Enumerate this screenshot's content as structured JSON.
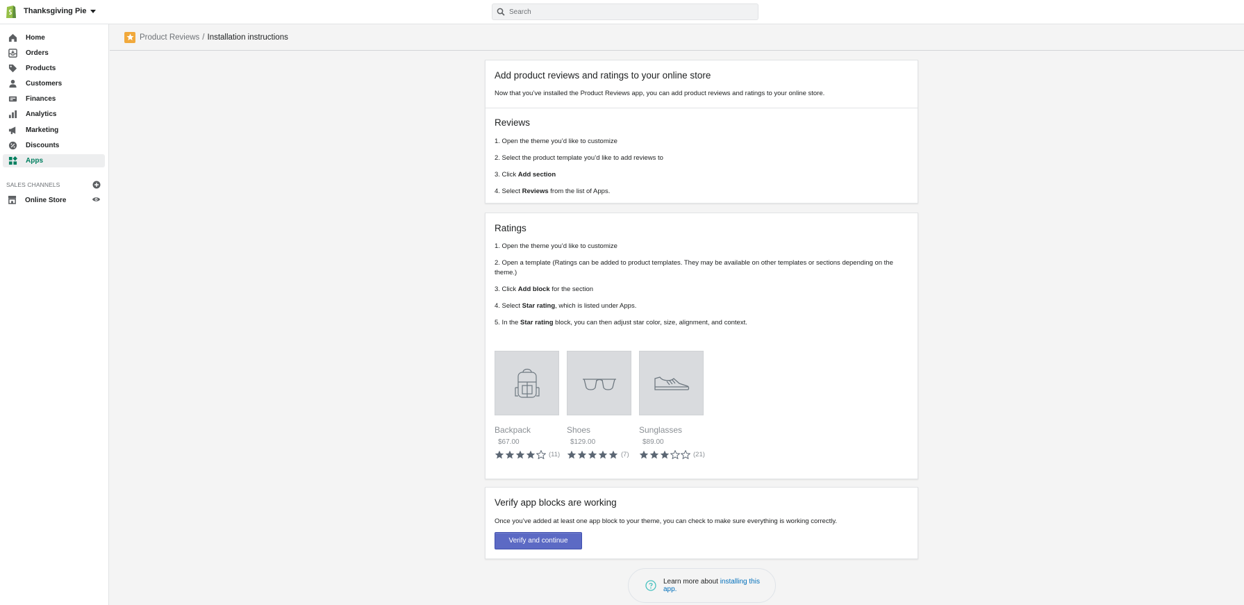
{
  "topbar": {
    "store_name": "Thanksgiving Pie",
    "search_placeholder": "Search"
  },
  "sidebar": {
    "items": [
      {
        "label": "Home",
        "icon": "home-icon",
        "active": false
      },
      {
        "label": "Orders",
        "icon": "orders-icon",
        "active": false
      },
      {
        "label": "Products",
        "icon": "tag-icon",
        "active": false
      },
      {
        "label": "Customers",
        "icon": "person-icon",
        "active": false
      },
      {
        "label": "Finances",
        "icon": "finances-icon",
        "active": false
      },
      {
        "label": "Analytics",
        "icon": "bar-chart-icon",
        "active": false
      },
      {
        "label": "Marketing",
        "icon": "megaphone-icon",
        "active": false
      },
      {
        "label": "Discounts",
        "icon": "discount-icon",
        "active": false
      },
      {
        "label": "Apps",
        "icon": "apps-icon",
        "active": true
      }
    ],
    "sales_channels_title": "SALES CHANNELS",
    "channels": [
      {
        "label": "Online Store",
        "icon": "store-icon"
      }
    ]
  },
  "breadcrumb": {
    "app": "Product Reviews",
    "separator": "/",
    "current": "Installation instructions"
  },
  "intro": {
    "title": "Add product reviews and ratings to your online store",
    "text": "Now that you’ve installed the Product Reviews app, you can add product reviews and ratings to your online store."
  },
  "reviews": {
    "title": "Reviews",
    "steps": [
      {
        "before": "1. Open the theme you’d like to customize",
        "bold": "",
        "after": ""
      },
      {
        "before": "2. Select the product template you’d like to add reviews to",
        "bold": "",
        "after": ""
      },
      {
        "before": "3. Click ",
        "bold": "Add section",
        "after": ""
      },
      {
        "before": "4. Select ",
        "bold": "Reviews",
        "after": " from the list of Apps."
      }
    ]
  },
  "ratings": {
    "title": "Ratings",
    "steps": [
      {
        "before": "1. Open the theme you’d like to customize",
        "bold": "",
        "after": ""
      },
      {
        "before": "2. Open a template (Ratings can be added to product templates. They may be available on other templates or sections depending on the theme.)",
        "bold": "",
        "after": ""
      },
      {
        "before": "3. Click ",
        "bold": "Add block",
        "after": " for the section"
      },
      {
        "before": "4. Select ",
        "bold": "Star rating",
        "after": ", which is listed under Apps."
      },
      {
        "before": "5. In the ",
        "bold": "Star rating",
        "after": " block, you can then adjust star color, size, alignment, and context."
      }
    ],
    "products": [
      {
        "name": "Backpack",
        "price": "$67.00",
        "rating": 4,
        "count": "(11)",
        "icon": "backpack-icon"
      },
      {
        "name": "Shoes",
        "price": "$129.00",
        "rating": 5,
        "count": "(7)",
        "icon": "sunglasses-icon"
      },
      {
        "name": "Sunglasses",
        "price": "$89.00",
        "rating": 3,
        "count": "(21)",
        "icon": "shoe-icon"
      }
    ]
  },
  "verify": {
    "title": "Verify app blocks are working",
    "text": "Once you’ve added at least one app block to your theme, you can check to make sure everything is working correctly.",
    "button_label": "Verify and continue"
  },
  "help": {
    "text": "Learn more about ",
    "link_text": "installing this app."
  },
  "colors": {
    "accent_green": "#007f5f",
    "primary_button": "#5c6ac4",
    "link": "#006fbb",
    "app_icon": "#f1a93c",
    "star": "#5b6673"
  }
}
